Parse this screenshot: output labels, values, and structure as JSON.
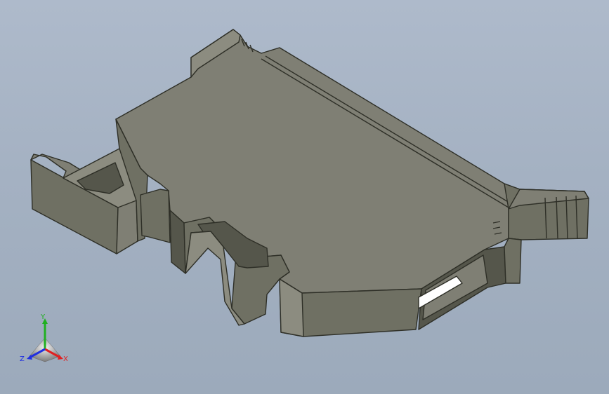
{
  "viewport": {
    "background": "#a9b5c6"
  },
  "part": {
    "face_color": "#7f7f74",
    "side_color": "#6f7063",
    "dark_color": "#55564b",
    "edge_color": "#2e2f27",
    "light_color": "#8c8c80",
    "window_highlight": "#ffffff"
  },
  "triad": {
    "x_label": "X",
    "y_label": "Y",
    "z_label": "Z",
    "x_color": "#e02020",
    "y_color": "#20b020",
    "z_color": "#2030e0"
  }
}
